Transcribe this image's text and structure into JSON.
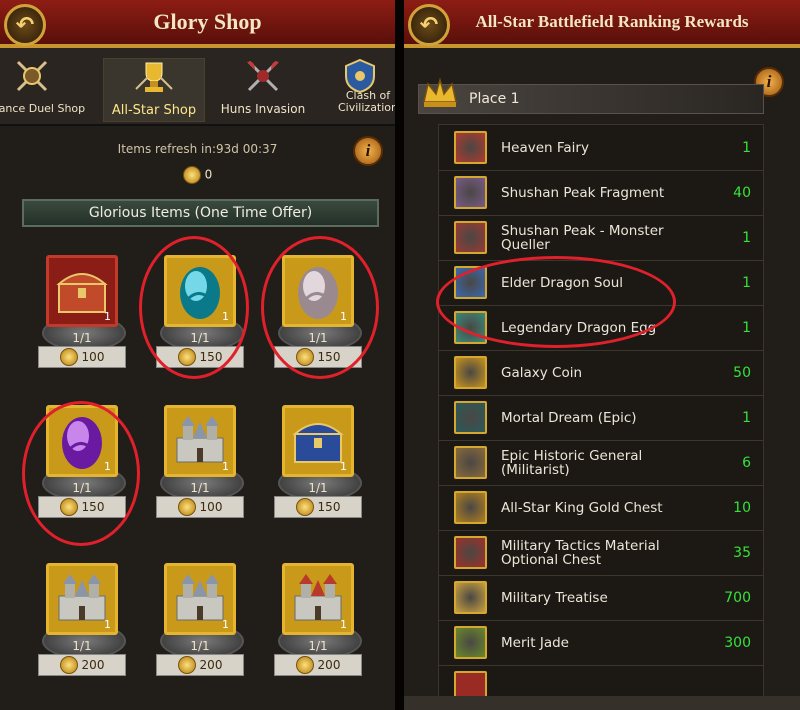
{
  "left": {
    "title": "Glory Shop",
    "tabs": [
      {
        "label": "Alliance Duel Shop",
        "icon": "crossed-swords-emblem-icon"
      },
      {
        "label": "All-Star Shop",
        "icon": "trophy-emblem-icon",
        "active": true
      },
      {
        "label": "Huns Invasion",
        "icon": "crossed-axes-emblem-icon"
      },
      {
        "label": "Clash of Civilizations",
        "icon": "shield-emblem-icon"
      }
    ],
    "refresh_text": "Items refresh in:93d 00:37",
    "coin_balance": "0",
    "banner": "Glorious Items (One Time Offer)",
    "items": [
      {
        "icon": "red-treasure-chest-icon",
        "qty": "1",
        "stock": "1/1",
        "price": "100",
        "frame": "red"
      },
      {
        "icon": "teal-dragon-egg-icon",
        "qty": "1",
        "stock": "1/1",
        "price": "150",
        "frame": "gold"
      },
      {
        "icon": "white-dragon-egg-icon",
        "qty": "1",
        "stock": "1/1",
        "price": "150",
        "frame": "gold"
      },
      {
        "icon": "purple-dragon-egg-icon",
        "qty": "1",
        "stock": "1/1",
        "price": "150",
        "frame": "gold"
      },
      {
        "icon": "castle-icon",
        "qty": "1",
        "stock": "1/1",
        "price": "100",
        "frame": "gold"
      },
      {
        "icon": "gold-treasure-chest-icon",
        "qty": "1",
        "stock": "1/1",
        "price": "150",
        "frame": "gold"
      },
      {
        "icon": "fortress-icon",
        "qty": "1",
        "stock": "1/1",
        "price": "200",
        "frame": "gold"
      },
      {
        "icon": "cathedral-icon",
        "qty": "1",
        "stock": "1/1",
        "price": "200",
        "frame": "gold"
      },
      {
        "icon": "red-roof-hall-icon",
        "qty": "1",
        "stock": "1/1",
        "price": "200",
        "frame": "gold"
      }
    ]
  },
  "right": {
    "title": "All-Star Battlefield Ranking Rewards",
    "place": "Place 1",
    "rewards": [
      {
        "name": "Heaven Fairy",
        "count": "1",
        "icon": "fairy-icon",
        "bg": "#b03a2e"
      },
      {
        "name": "Shushan Peak Fragment",
        "count": "40",
        "icon": "mountain-fragment-icon",
        "bg": "#7a5a8a"
      },
      {
        "name": "Shushan Peak - Monster Queller",
        "count": "1",
        "icon": "monster-queller-icon",
        "bg": "#9a3a34"
      },
      {
        "name": "Elder Dragon Soul",
        "count": "1",
        "icon": "dragon-soul-icon",
        "bg": "#3a6ab0"
      },
      {
        "name": "Legendary Dragon Egg",
        "count": "1",
        "icon": "dragon-egg-icon",
        "bg": "#3a8a7a"
      },
      {
        "name": "Galaxy Coin",
        "count": "50",
        "icon": "galaxy-coin-icon",
        "bg": "#c9941e"
      },
      {
        "name": "Mortal Dream (Epic)",
        "count": "1",
        "icon": "mortal-dream-icon",
        "bg": "#2a5a5a"
      },
      {
        "name": "Epic Historic General (Militarist)",
        "count": "6",
        "icon": "general-scroll-icon",
        "bg": "#8a6a3a"
      },
      {
        "name": "All-Star King Gold Chest",
        "count": "10",
        "icon": "gold-chest-icon",
        "bg": "#b08020"
      },
      {
        "name": "Military Tactics Material Optional Chest",
        "count": "35",
        "icon": "red-chest-icon",
        "bg": "#a0302a"
      },
      {
        "name": "Military Treatise",
        "count": "700",
        "icon": "treatise-book-icon",
        "bg": "#c9a040"
      },
      {
        "name": "Merit Jade",
        "count": "300",
        "icon": "jade-icon",
        "bg": "#6a8a2a"
      }
    ]
  },
  "colors": {
    "header_red": "#8d1d14",
    "gold_border": "#c8962e",
    "count_green": "#36e23a",
    "highlight_circle": "#e0202a"
  }
}
